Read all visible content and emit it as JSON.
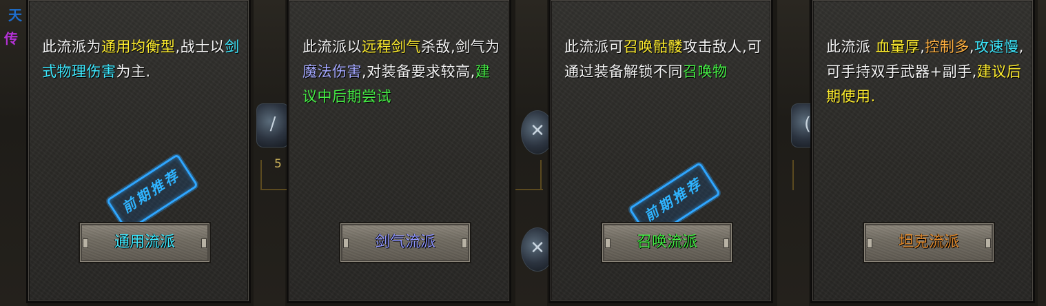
{
  "background": {
    "left_chars": [
      "天",
      "传"
    ],
    "number_fragment": "5"
  },
  "panels": [
    {
      "id": "general",
      "segments": [
        {
          "text": "此流派为",
          "color": "white"
        },
        {
          "text": "通用均衡型",
          "color": "yellow"
        },
        {
          "text": ",战士以",
          "color": "white"
        },
        {
          "text": "剑式物理伤害",
          "color": "cyan"
        },
        {
          "text": "为主.",
          "color": "white"
        }
      ],
      "button_label": "通用流派",
      "button_color": "#3de9ff",
      "stamp": "前期推荐"
    },
    {
      "id": "sword-qi",
      "segments": [
        {
          "text": "此流派以",
          "color": "white"
        },
        {
          "text": "远程剑气",
          "color": "yellow"
        },
        {
          "text": "杀敌,剑气为",
          "color": "white"
        },
        {
          "text": "魔法伤害",
          "color": "blue"
        },
        {
          "text": ",对装备要求较高,",
          "color": "white"
        },
        {
          "text": "建议中后期尝试",
          "color": "green"
        }
      ],
      "button_label": "剑气流派",
      "button_color": "#8f96ff",
      "stamp": ""
    },
    {
      "id": "summon",
      "segments": [
        {
          "text": "此流派可",
          "color": "white"
        },
        {
          "text": "召唤骷髅",
          "color": "yellow"
        },
        {
          "text": "攻击敌人,可通过装备解锁不同",
          "color": "white"
        },
        {
          "text": "召唤物",
          "color": "green"
        }
      ],
      "button_label": "召唤流派",
      "button_color": "#45ee45",
      "stamp": "前期推荐"
    },
    {
      "id": "tank",
      "segments": [
        {
          "text": "此流派 ",
          "color": "white"
        },
        {
          "text": "血量厚",
          "color": "yellow"
        },
        {
          "text": ",",
          "color": "white"
        },
        {
          "text": "控制多",
          "color": "orange"
        },
        {
          "text": ",",
          "color": "white"
        },
        {
          "text": "攻速慢",
          "color": "cyan"
        },
        {
          "text": ",可手持双手武器+副手,",
          "color": "white"
        },
        {
          "text": "建议后期使用.",
          "color": "yellow"
        }
      ],
      "button_label": "坦克流派",
      "button_color": "#e08a2e",
      "stamp": ""
    }
  ]
}
